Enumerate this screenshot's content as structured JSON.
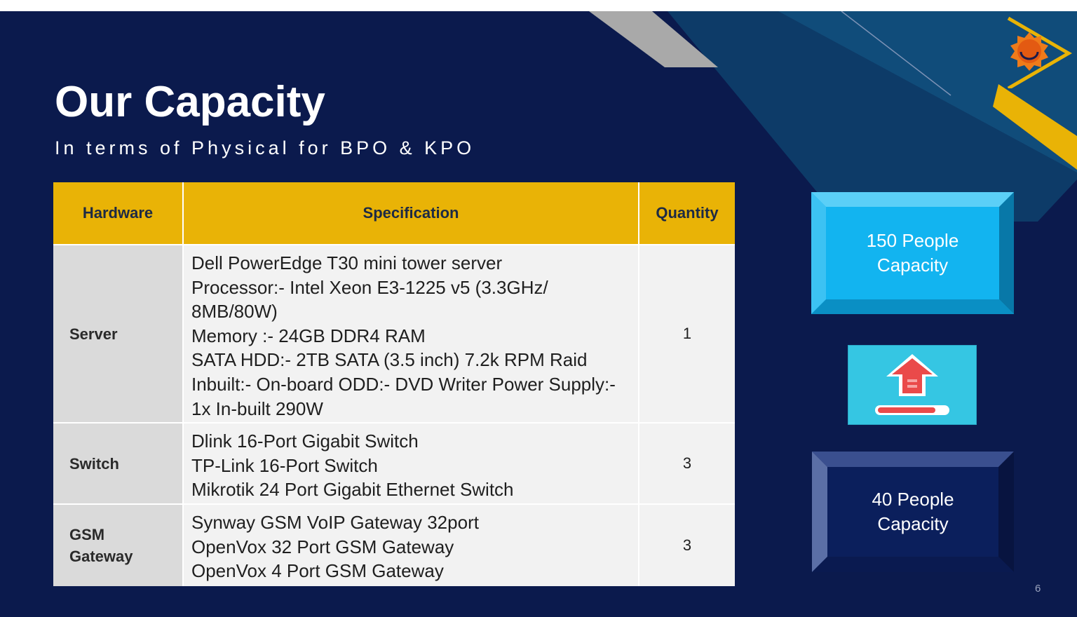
{
  "slide": {
    "title": "Our Capacity",
    "subtitle": "In terms of Physical for BPO & KPO",
    "page_number": "6"
  },
  "table": {
    "headers": {
      "hardware": "Hardware",
      "specification": "Specification",
      "quantity": "Quantity"
    },
    "rows": [
      {
        "hardware": "Server",
        "spec": [
          "Dell PowerEdge T30 mini tower server",
          "Processor:- Intel Xeon E3-1225 v5 (3.3GHz/",
          "8MB/80W)",
          "Memory :- 24GB DDR4 RAM",
          "SATA HDD:-  2TB SATA (3.5 inch) 7.2k RPM Raid",
          "Inbuilt:- On-board ODD:- DVD Writer Power Supply:-",
          "1x In-built 290W"
        ],
        "quantity": "1"
      },
      {
        "hardware": "Switch",
        "spec": [
          "Dlink 16-Port Gigabit Switch",
          "TP-Link 16-Port Switch",
          "Mikrotik 24 Port Gigabit Ethernet Switch"
        ],
        "quantity": "3"
      },
      {
        "hardware_lines": [
          "GSM",
          "Gateway"
        ],
        "spec": [
          "Synway GSM VoIP Gateway 32port",
          "OpenVox 32 Port GSM Gateway",
          "OpenVox 4 Port GSM Gateway"
        ],
        "quantity": "3"
      }
    ]
  },
  "capacity_boxes": {
    "top": {
      "line1": "150 People",
      "line2": "Capacity"
    },
    "bottom": {
      "line1": "40 People",
      "line2": "Capacity"
    }
  },
  "icons": {
    "logo": "sun-triangle-logo-icon",
    "upload": "upload-arrow-icon"
  },
  "colors": {
    "background": "#0b1a4d",
    "header_gold": "#e9b306",
    "box_top": "#0fb0ee",
    "box_bottom": "#0b1f5c",
    "upload_card": "#35c6e3",
    "arrow_red": "#ea4a4a"
  }
}
